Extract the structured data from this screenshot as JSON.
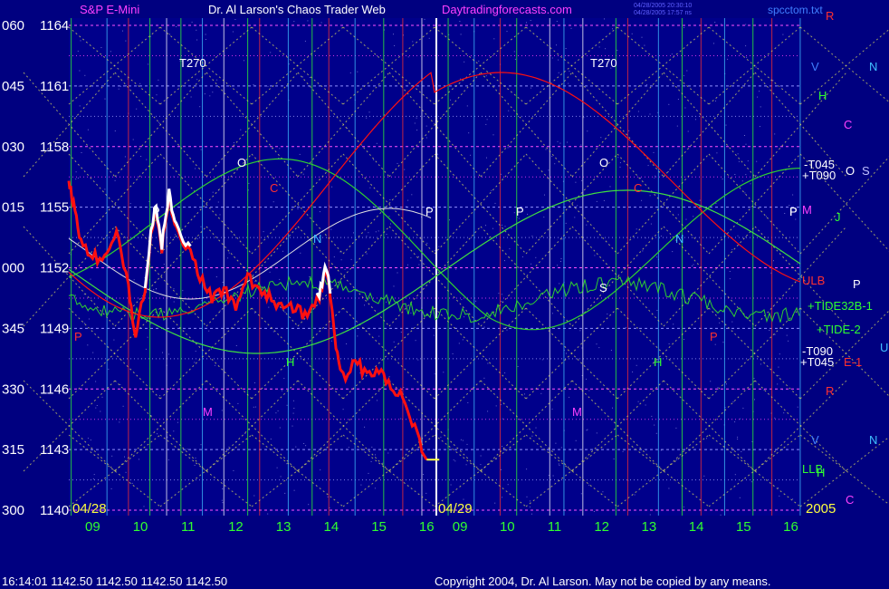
{
  "header": {
    "instrument": "S&P E-Mini",
    "title": "Dr. Al Larson's Chaos Trader Web",
    "website": "Daytradingforecasts.com",
    "timestamp1": "04/28/2005 20:30:10",
    "timestamp2": "04/28/2005 17:57 ns",
    "filename": "spcctom.txt"
  },
  "footer": {
    "quote": "16:14:01  1142.50 1142.50 1142.50 1142.50",
    "copyright": "Copyright 2004, Dr. Al Larson. May not be copied by any means."
  },
  "colors": {
    "background": "#000080",
    "plot_background": "#00008b",
    "price_red": "#ff1010",
    "price_white": "#ffffff",
    "tide_green": "#30d030",
    "flux_yellow": "#e0e060",
    "grid_red": "#ff3030",
    "grid_green": "#30ff30",
    "grid_cyan": "#40c0ff",
    "grid_magenta": "#ff40ff"
  },
  "chart_data": {
    "type": "line",
    "x_tick_labels": [
      "09",
      "10",
      "11",
      "12",
      "13",
      "14",
      "15",
      "16",
      "09",
      "10",
      "11",
      "12",
      "13",
      "14",
      "15",
      "16"
    ],
    "date_labels": [
      "04/28",
      "04/29",
      "2005"
    ],
    "y_left_angle_labels": [
      "060",
      "045",
      "030",
      "015",
      "000",
      "345",
      "330",
      "315",
      "300"
    ],
    "y_price_labels": [
      "1164",
      "1161",
      "1158",
      "1155",
      "1152",
      "1149",
      "1146",
      "1143",
      "1140"
    ],
    "ylim": [
      1140,
      1164
    ],
    "price_series": {
      "hours": [
        8.5,
        8.6,
        8.75,
        9.0,
        9.25,
        9.5,
        9.75,
        9.9,
        10.1,
        10.3,
        10.45,
        10.6,
        10.75,
        11.0,
        11.25,
        11.5,
        11.75,
        12.0,
        12.25,
        12.5,
        12.75,
        13.0,
        13.25,
        13.5,
        13.75,
        13.9,
        14.1,
        14.25,
        14.5,
        14.75,
        15.0,
        15.25,
        15.5,
        15.75,
        16.0
      ],
      "values": [
        1156.5,
        1155.0,
        1153.5,
        1152.5,
        1152.5,
        1154.0,
        1151.0,
        1148.5,
        1151.0,
        1155.0,
        1153.0,
        1155.5,
        1154.0,
        1153.0,
        1151.5,
        1150.5,
        1151.0,
        1150.0,
        1151.5,
        1151.0,
        1150.5,
        1150.0,
        1150.0,
        1149.5,
        1150.5,
        1152.0,
        1148.0,
        1146.5,
        1147.5,
        1146.5,
        1147.0,
        1146.0,
        1145.5,
        1144.0,
        1142.5
      ]
    },
    "day2_start_hour": 8.5,
    "right_labels": [
      {
        "text": "R",
        "color": "#ff3030"
      },
      {
        "text": "V",
        "color": "#4080ff"
      },
      {
        "text": "N",
        "color": "#40c0ff"
      },
      {
        "text": "H",
        "color": "#30ff30"
      },
      {
        "text": "C",
        "color": "#ff40ff"
      },
      {
        "text": "-T045",
        "color": "#ffffff"
      },
      {
        "text": "+T090",
        "color": "#ffffff"
      },
      {
        "text": "O",
        "color": "#ffffff"
      },
      {
        "text": "S",
        "color": "#c0c0ff"
      },
      {
        "text": "P",
        "color": "#ffffff"
      },
      {
        "text": "M",
        "color": "#ff40ff"
      },
      {
        "text": "J",
        "color": "#30ff30"
      },
      {
        "text": "ULB",
        "color": "#ff3030"
      },
      {
        "text": "P",
        "color": "#ffffff"
      },
      {
        "text": "+TIDE32B-1",
        "color": "#30ff30"
      },
      {
        "text": "+TIDE-2",
        "color": "#30ff30"
      },
      {
        "text": "U",
        "color": "#40c0ff"
      },
      {
        "text": "-T090",
        "color": "#ffffff"
      },
      {
        "text": "+T045",
        "color": "#ffffff"
      },
      {
        "text": "E-1",
        "color": "#ff3030"
      },
      {
        "text": "R",
        "color": "#ff3030"
      },
      {
        "text": "V",
        "color": "#4080ff"
      },
      {
        "text": "N",
        "color": "#40c0ff"
      },
      {
        "text": "LLB",
        "color": "#30ff30"
      },
      {
        "text": "H",
        "color": "#30ff30"
      },
      {
        "text": "C",
        "color": "#ff40ff"
      }
    ],
    "inplot_labels": [
      {
        "text": "T270",
        "color": "#ffffff"
      },
      {
        "text": "T270",
        "color": "#ffffff"
      },
      {
        "text": "O",
        "color": "#ffffff"
      },
      {
        "text": "O",
        "color": "#ffffff"
      },
      {
        "text": "C",
        "color": "#ff3030"
      },
      {
        "text": "C",
        "color": "#ff3030"
      },
      {
        "text": "P",
        "color": "#ffffff"
      },
      {
        "text": "P",
        "color": "#ffffff"
      },
      {
        "text": "P",
        "color": "#ffffff"
      },
      {
        "text": "P",
        "color": "#ffffff"
      },
      {
        "text": "N",
        "color": "#40c0ff"
      },
      {
        "text": "N",
        "color": "#40c0ff"
      },
      {
        "text": "S",
        "color": "#ffffff"
      },
      {
        "text": "H",
        "color": "#30ff30"
      },
      {
        "text": "H",
        "color": "#30ff30"
      },
      {
        "text": "M",
        "color": "#ff40ff"
      },
      {
        "text": "M",
        "color": "#ff40ff"
      },
      {
        "text": "P",
        "color": "#ff3030"
      },
      {
        "text": "P",
        "color": "#ff3030"
      }
    ]
  }
}
